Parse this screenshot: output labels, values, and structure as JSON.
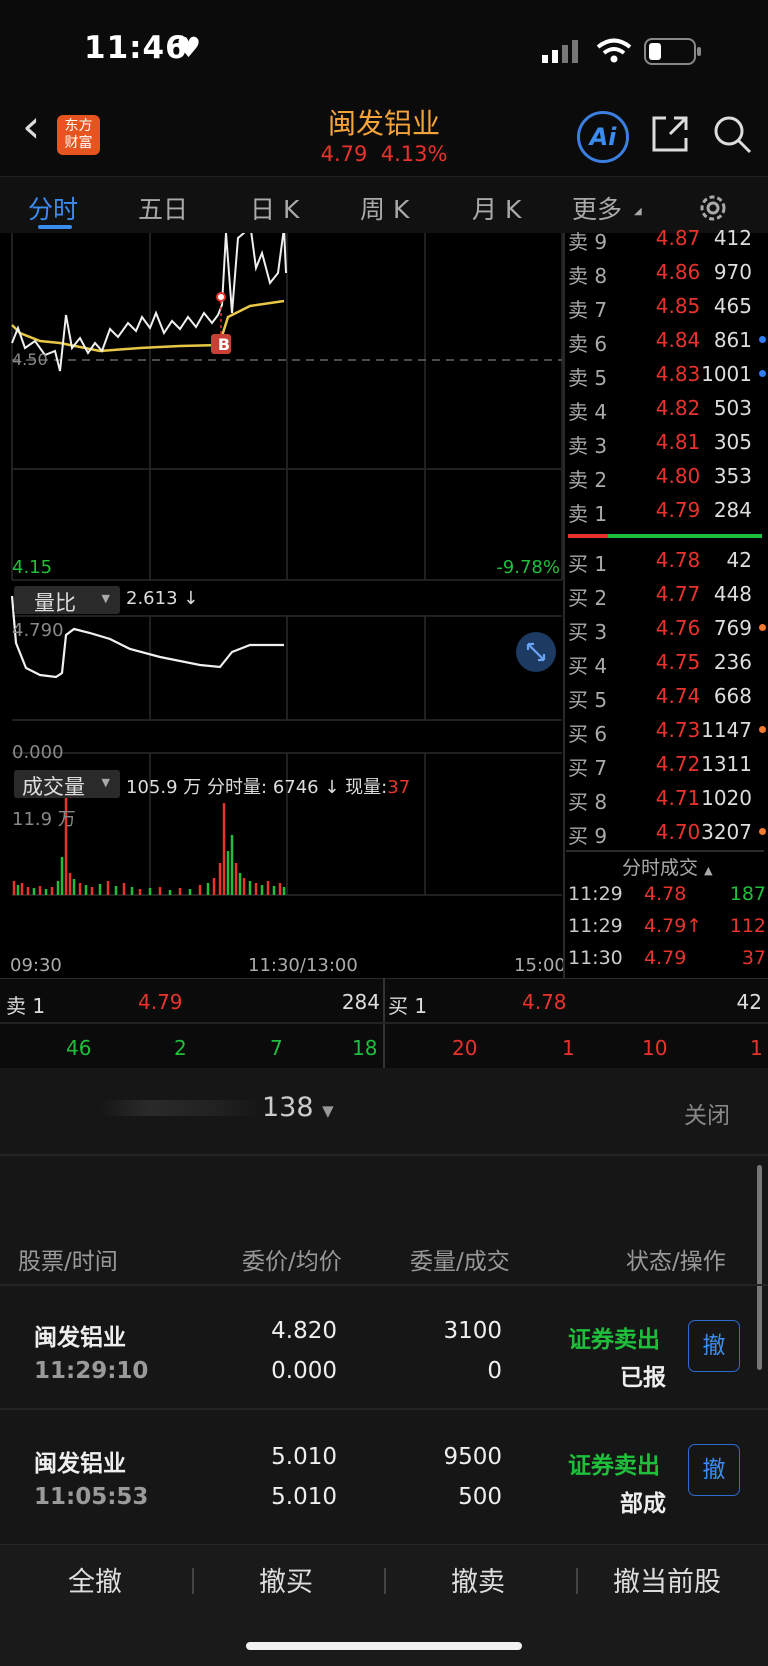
{
  "status": {
    "time": "11:46",
    "heart": "♥"
  },
  "header": {
    "back": "‹",
    "logo_line1": "东方",
    "logo_line2": "财富",
    "title": "闽发铝业",
    "price": "4.79",
    "change_pct": "4.13%",
    "ai_label": "Ai"
  },
  "tabs": [
    {
      "label": "分时"
    },
    {
      "label": "五日"
    },
    {
      "label": "日 K"
    },
    {
      "label": "周 K"
    },
    {
      "label": "月 K"
    },
    {
      "label": "更多"
    }
  ],
  "chart_data": {
    "type": "line",
    "price_axis_left_top": "4.50",
    "price_axis_left_bottom": "4.15",
    "pct_axis_right_bottom": "-9.78%",
    "trade_marker": "B",
    "x_ticks": [
      "09:30",
      "11:30/13:00",
      "15:00"
    ],
    "indicator1": {
      "name": "量比",
      "value": "2.613 ↓",
      "top": "4.790",
      "bottom": "0.000"
    },
    "indicator2": {
      "name": "成交量",
      "total": "105.9 万",
      "minute_label": "分时量:",
      "minute_vol": "6746 ↓",
      "cur_label": "现量:",
      "cur_vol": "37",
      "top": "11.9 万"
    }
  },
  "order_book": {
    "asks": [
      {
        "label": "卖 9",
        "price": "4.87",
        "vol": "412",
        "dot": ""
      },
      {
        "label": "卖 8",
        "price": "4.86",
        "vol": "970",
        "dot": ""
      },
      {
        "label": "卖 7",
        "price": "4.85",
        "vol": "465",
        "dot": ""
      },
      {
        "label": "卖 6",
        "price": "4.84",
        "vol": "861",
        "dot": "#2f7cf0"
      },
      {
        "label": "卖 5",
        "price": "4.83",
        "vol": "1001",
        "dot": "#2f7cf0"
      },
      {
        "label": "卖 4",
        "price": "4.82",
        "vol": "503",
        "dot": ""
      },
      {
        "label": "卖 3",
        "price": "4.81",
        "vol": "305",
        "dot": ""
      },
      {
        "label": "卖 2",
        "price": "4.80",
        "vol": "353",
        "dot": ""
      },
      {
        "label": "卖 1",
        "price": "4.79",
        "vol": "284",
        "dot": ""
      }
    ],
    "bids": [
      {
        "label": "买 1",
        "price": "4.78",
        "vol": "42",
        "dot": ""
      },
      {
        "label": "买 2",
        "price": "4.77",
        "vol": "448",
        "dot": ""
      },
      {
        "label": "买 3",
        "price": "4.76",
        "vol": "769",
        "dot": "#f07a2f"
      },
      {
        "label": "买 4",
        "price": "4.75",
        "vol": "236",
        "dot": ""
      },
      {
        "label": "买 5",
        "price": "4.74",
        "vol": "668",
        "dot": ""
      },
      {
        "label": "买 6",
        "price": "4.73",
        "vol": "1147",
        "dot": "#f07a2f"
      },
      {
        "label": "买 7",
        "price": "4.72",
        "vol": "1311",
        "dot": ""
      },
      {
        "label": "买 8",
        "price": "4.71",
        "vol": "1020",
        "dot": ""
      },
      {
        "label": "买 9",
        "price": "4.70",
        "vol": "3207",
        "dot": "#f07a2f"
      }
    ]
  },
  "ticks": {
    "title": "分时成交",
    "rows": [
      {
        "time": "11:29",
        "price": "4.78",
        "vol": "187",
        "vol_color": "green"
      },
      {
        "time": "11:29",
        "price": "4.79↑",
        "vol": "112",
        "vol_color": "red"
      },
      {
        "time": "11:30",
        "price": "4.79",
        "vol": "37",
        "vol_color": "red"
      }
    ]
  },
  "quote_bar": {
    "sell_label": "卖 1",
    "sell_price": "4.79",
    "sell_vol": "284",
    "buy_label": "买 1",
    "buy_price": "4.78",
    "buy_vol": "42",
    "sell_breakdown": [
      "46",
      "2",
      "7",
      "18"
    ],
    "buy_breakdown": [
      "20",
      "1",
      "10",
      "1"
    ]
  },
  "panel": {
    "account": "138",
    "close": "关闭",
    "headers": [
      "股票/时间",
      "委价/均价",
      "委量/成交",
      "状态/操作"
    ],
    "orders": [
      {
        "name": "闽发铝业",
        "time": "11:29:10",
        "price": "4.820",
        "avg": "0.000",
        "qty": "3100",
        "filled": "0",
        "side": "证券卖出",
        "status": "已报",
        "cancel": "撤"
      },
      {
        "name": "闽发铝业",
        "time": "11:05:53",
        "price": "5.010",
        "avg": "5.010",
        "qty": "9500",
        "filled": "500",
        "side": "证券卖出",
        "status": "部成",
        "cancel": "撤"
      }
    ],
    "actions": [
      "全撤",
      "撤买",
      "撤卖",
      "撤当前股"
    ]
  }
}
